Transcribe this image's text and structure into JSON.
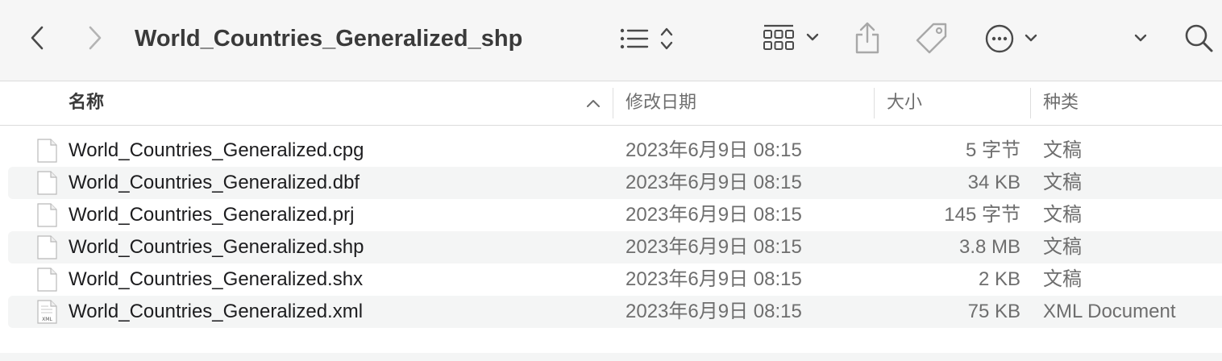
{
  "toolbar": {
    "title": "World_Countries_Generalized_shp",
    "icons": {
      "back": "chevron-left-icon",
      "forward": "chevron-right-icon",
      "view": "list-view-icon",
      "group": "group-grid-icon",
      "share": "share-icon",
      "tag": "tag-icon",
      "more": "ellipsis-circle-icon",
      "expand": "chevron-down-icon",
      "search": "search-icon"
    }
  },
  "columns": {
    "name": "名称",
    "date": "修改日期",
    "size": "大小",
    "kind": "种类"
  },
  "files": [
    {
      "name": "World_Countries_Generalized.cpg",
      "date": "2023年6月9日 08:15",
      "size": "5 字节",
      "kind": "文稿",
      "icon": "document-icon"
    },
    {
      "name": "World_Countries_Generalized.dbf",
      "date": "2023年6月9日 08:15",
      "size": "34 KB",
      "kind": "文稿",
      "icon": "document-icon"
    },
    {
      "name": "World_Countries_Generalized.prj",
      "date": "2023年6月9日 08:15",
      "size": "145 字节",
      "kind": "文稿",
      "icon": "document-icon"
    },
    {
      "name": "World_Countries_Generalized.shp",
      "date": "2023年6月9日 08:15",
      "size": "3.8 MB",
      "kind": "文稿",
      "icon": "document-icon"
    },
    {
      "name": "World_Countries_Generalized.shx",
      "date": "2023年6月9日 08:15",
      "size": "2 KB",
      "kind": "文稿",
      "icon": "document-icon"
    },
    {
      "name": "World_Countries_Generalized.xml",
      "date": "2023年6月9日 08:15",
      "size": "75 KB",
      "kind": "XML Document",
      "icon": "xml-document-icon",
      "icon_label": "XML"
    }
  ]
}
